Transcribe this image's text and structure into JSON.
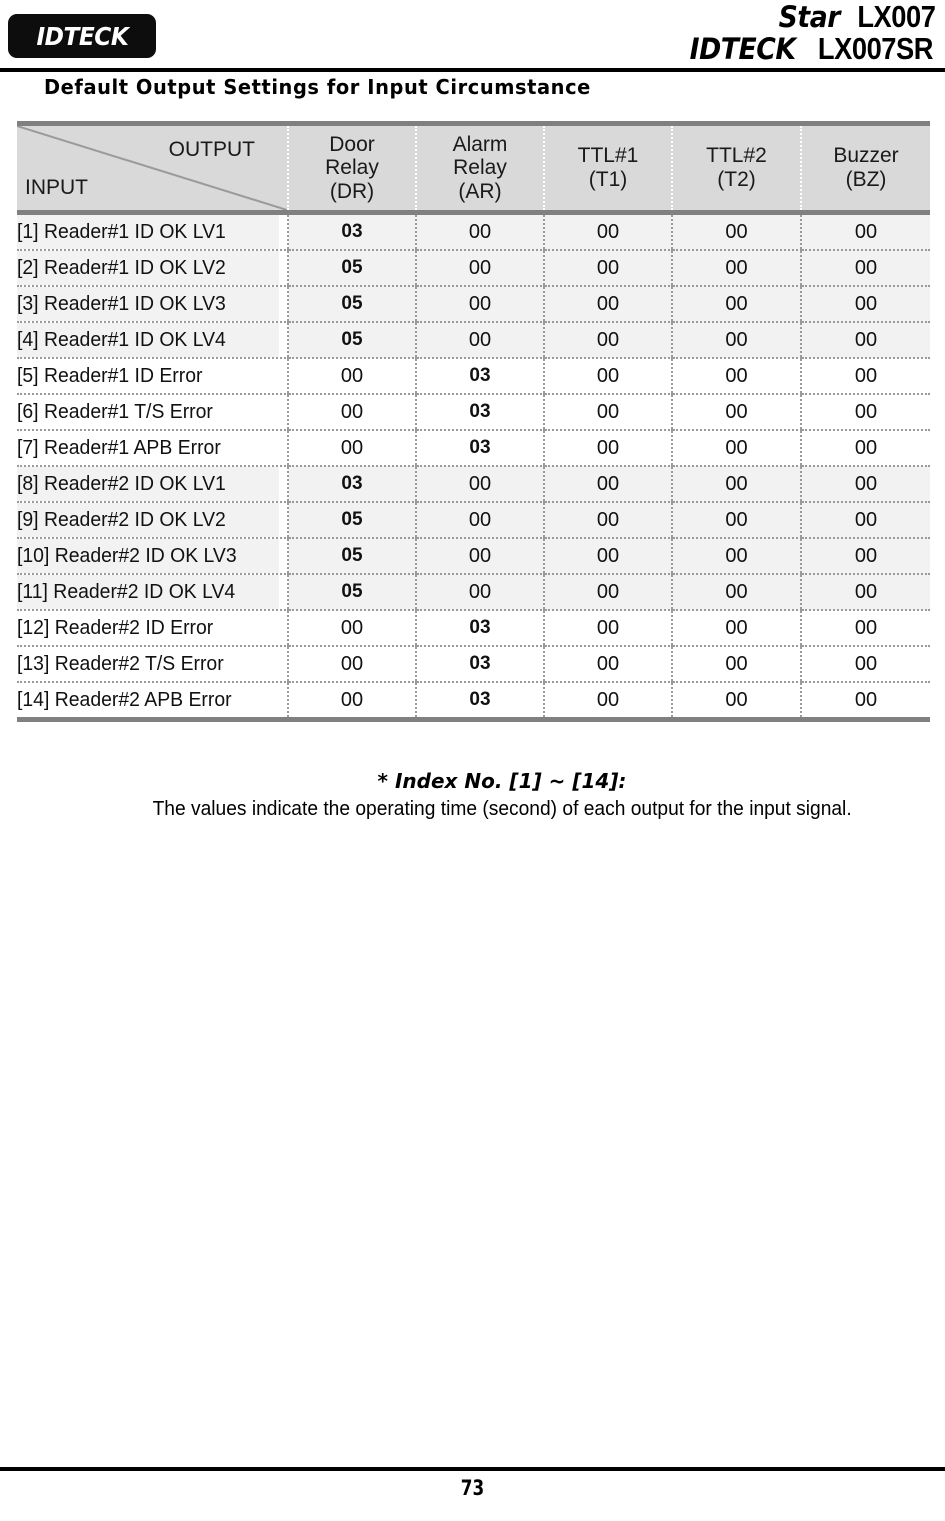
{
  "header": {
    "logo_text": "IDTECK",
    "model_line_1_italic": "Star",
    "model_line_1_plain": "LX007",
    "model_line_2_italic": "IDTECK",
    "model_line_2_plain": "LX007SR"
  },
  "section": {
    "title": "Default Output Settings for Input Circumstance"
  },
  "table": {
    "corner": {
      "output_label": "OUTPUT",
      "input_label": "INPUT"
    },
    "columns": [
      {
        "line1": "Door",
        "line2": "Relay",
        "line3": "(DR)"
      },
      {
        "line1": "Alarm",
        "line2": "Relay",
        "line3": "(AR)"
      },
      {
        "line1": "TTL#1",
        "line2": "(T1)",
        "line3": ""
      },
      {
        "line1": "TTL#2",
        "line2": "(T2)",
        "line3": ""
      },
      {
        "line1": "Buzzer",
        "line2": "(BZ)",
        "line3": ""
      }
    ],
    "rows": [
      {
        "label": "[1] Reader#1 ID OK LV1",
        "dr": "03",
        "ar": "00",
        "t1": "00",
        "t2": "00",
        "bz": "00",
        "bold": "dr",
        "shaded": true
      },
      {
        "label": "[2] Reader#1 ID OK LV2",
        "dr": "05",
        "ar": "00",
        "t1": "00",
        "t2": "00",
        "bz": "00",
        "bold": "dr",
        "shaded": true
      },
      {
        "label": "[3] Reader#1 ID OK LV3",
        "dr": "05",
        "ar": "00",
        "t1": "00",
        "t2": "00",
        "bz": "00",
        "bold": "dr",
        "shaded": true
      },
      {
        "label": "[4] Reader#1 ID OK LV4",
        "dr": "05",
        "ar": "00",
        "t1": "00",
        "t2": "00",
        "bz": "00",
        "bold": "dr",
        "shaded": true
      },
      {
        "label": "[5] Reader#1 ID Error",
        "dr": "00",
        "ar": "03",
        "t1": "00",
        "t2": "00",
        "bz": "00",
        "bold": "ar",
        "shaded": false
      },
      {
        "label": "[6] Reader#1 T/S Error",
        "dr": "00",
        "ar": "03",
        "t1": "00",
        "t2": "00",
        "bz": "00",
        "bold": "ar",
        "shaded": false
      },
      {
        "label": "[7] Reader#1 APB Error",
        "dr": "00",
        "ar": "03",
        "t1": "00",
        "t2": "00",
        "bz": "00",
        "bold": "ar",
        "shaded": false
      },
      {
        "label": "[8] Reader#2 ID OK LV1",
        "dr": "03",
        "ar": "00",
        "t1": "00",
        "t2": "00",
        "bz": "00",
        "bold": "dr",
        "shaded": true
      },
      {
        "label": "[9] Reader#2 ID OK LV2",
        "dr": "05",
        "ar": "00",
        "t1": "00",
        "t2": "00",
        "bz": "00",
        "bold": "dr",
        "shaded": true
      },
      {
        "label": "[10] Reader#2 ID OK LV3",
        "dr": "05",
        "ar": "00",
        "t1": "00",
        "t2": "00",
        "bz": "00",
        "bold": "dr",
        "shaded": true
      },
      {
        "label": "[11] Reader#2 ID OK LV4",
        "dr": "05",
        "ar": "00",
        "t1": "00",
        "t2": "00",
        "bz": "00",
        "bold": "dr",
        "shaded": true
      },
      {
        "label": "[12] Reader#2 ID Error",
        "dr": "00",
        "ar": "03",
        "t1": "00",
        "t2": "00",
        "bz": "00",
        "bold": "ar",
        "shaded": false
      },
      {
        "label": "[13] Reader#2 T/S Error",
        "dr": "00",
        "ar": "03",
        "t1": "00",
        "t2": "00",
        "bz": "00",
        "bold": "ar",
        "shaded": false
      },
      {
        "label": "[14] Reader#2 APB Error",
        "dr": "00",
        "ar": "03",
        "t1": "00",
        "t2": "00",
        "bz": "00",
        "bold": "ar",
        "shaded": false
      }
    ]
  },
  "footnote": {
    "lead": "* Index No. [1] ~ [14]:",
    "body": "The values indicate the operating time (second) of each output for the input signal."
  },
  "footer": {
    "page_number": "73"
  },
  "colors": {
    "header_fill": "#d9d9d9",
    "row_shaded": "#f2f2f2",
    "rule": "#808080",
    "text": "#000000"
  }
}
